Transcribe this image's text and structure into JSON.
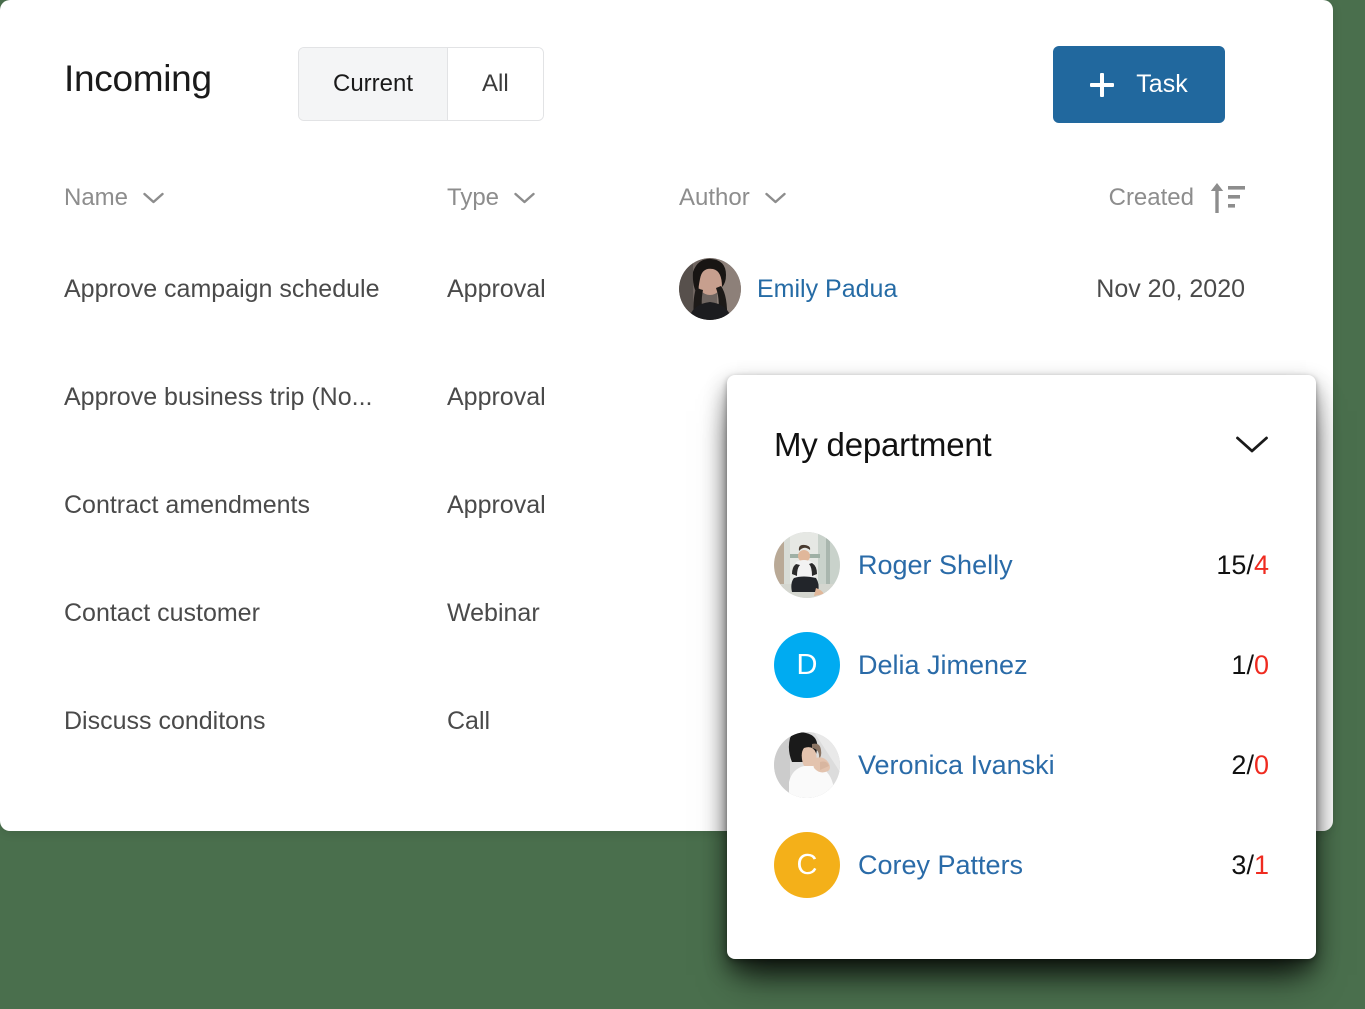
{
  "theme": {
    "background": "#4a6f4d",
    "accent_blue": "#21689e",
    "link_blue": "#256ba5",
    "overdue_red": "#ef2b20"
  },
  "header": {
    "title": "Incoming",
    "toggle": {
      "options": [
        "Current",
        "All"
      ],
      "selected": "Current"
    },
    "task_button": {
      "label": "Task",
      "icon": "plus-icon"
    }
  },
  "table": {
    "columns": [
      {
        "label": "Name",
        "icon": "chevron-down-icon"
      },
      {
        "label": "Type",
        "icon": "chevron-down-icon"
      },
      {
        "label": "Author",
        "icon": "chevron-down-icon"
      },
      {
        "label": "Created",
        "icon": "sort-descending-icon"
      }
    ],
    "rows": [
      {
        "name": "Approve campaign schedule",
        "type": "Approval",
        "author": "Emily Padua",
        "author_avatar": "photo-woman-dark-hair",
        "created": "Nov 20, 2020"
      },
      {
        "name": "Approve business trip (No...",
        "type": "Approval",
        "author": "",
        "author_avatar": "",
        "created": ""
      },
      {
        "name": "Contract amendments",
        "type": "Approval",
        "author": "",
        "author_avatar": "",
        "created": ""
      },
      {
        "name": "Contact customer",
        "type": "Webinar",
        "author": "",
        "author_avatar": "",
        "created": ""
      },
      {
        "name": "Discuss conditons",
        "type": "Call",
        "author": "",
        "author_avatar": "",
        "created": ""
      }
    ]
  },
  "popup": {
    "title": "My department",
    "collapse_icon": "chevron-down-icon",
    "members": [
      {
        "name": "Roger Shelly",
        "avatar_type": "photo",
        "avatar": "photo-man-sitting",
        "initial": "",
        "initial_color": "",
        "total": "15",
        "separator": "/",
        "overdue": "4"
      },
      {
        "name": "Delia Jimenez",
        "avatar_type": "initial",
        "avatar": "",
        "initial": "D",
        "initial_color": "#00ABF1",
        "total": "1",
        "separator": "/",
        "overdue": "0"
      },
      {
        "name": "Veronica Ivanski",
        "avatar_type": "photo",
        "avatar": "photo-woman-white-shirt",
        "initial": "",
        "initial_color": "",
        "total": "2",
        "separator": "/",
        "overdue": "0"
      },
      {
        "name": "Corey Patters",
        "avatar_type": "initial",
        "avatar": "",
        "initial": "C",
        "initial_color": "#F4B019",
        "total": "3",
        "separator": "/",
        "overdue": "1"
      }
    ]
  }
}
